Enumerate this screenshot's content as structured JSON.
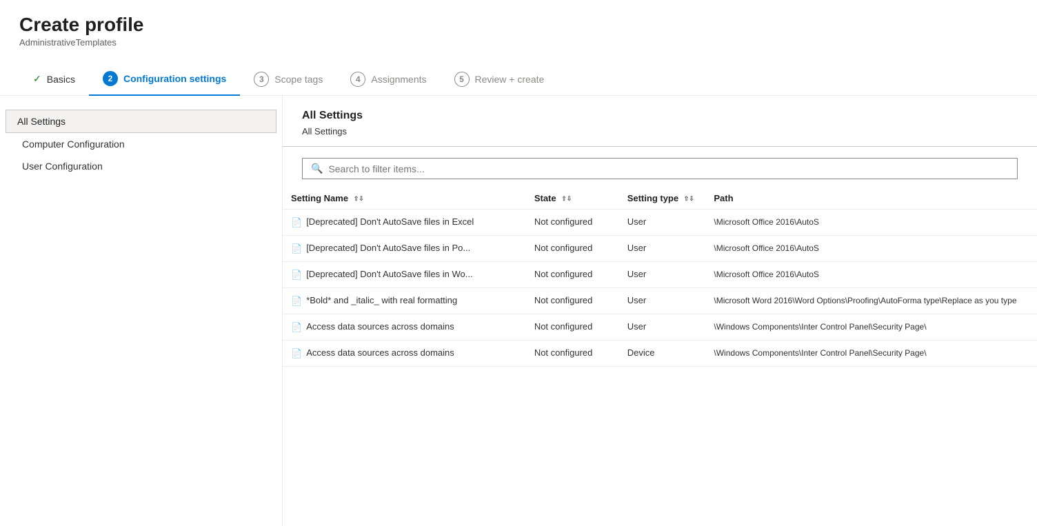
{
  "header": {
    "title": "Create profile",
    "subtitle": "AdministrativeTemplates"
  },
  "wizard": {
    "steps": [
      {
        "id": "basics",
        "number": "✓",
        "label": "Basics",
        "state": "completed"
      },
      {
        "id": "config",
        "number": "2",
        "label": "Configuration settings",
        "state": "active"
      },
      {
        "id": "scope",
        "number": "3",
        "label": "Scope tags",
        "state": "inactive"
      },
      {
        "id": "assignments",
        "number": "4",
        "label": "Assignments",
        "state": "inactive"
      },
      {
        "id": "review",
        "number": "5",
        "label": "Review + create",
        "state": "inactive"
      }
    ]
  },
  "sidebar": {
    "items": [
      {
        "id": "all-settings",
        "label": "All Settings",
        "selected": true,
        "level": 0
      },
      {
        "id": "computer-config",
        "label": "Computer Configuration",
        "selected": false,
        "level": 1
      },
      {
        "id": "user-config",
        "label": "User Configuration",
        "selected": false,
        "level": 1
      }
    ]
  },
  "content": {
    "heading": "All Settings",
    "breadcrumb": "All Settings",
    "search_placeholder": "Search to filter items...",
    "table": {
      "columns": [
        {
          "id": "setting-name",
          "label": "Setting Name"
        },
        {
          "id": "state",
          "label": "State"
        },
        {
          "id": "setting-type",
          "label": "Setting type"
        },
        {
          "id": "path",
          "label": "Path"
        }
      ],
      "rows": [
        {
          "name": "[Deprecated] Don't AutoSave files in Excel",
          "state": "Not configured",
          "type": "User",
          "path": "\\Microsoft Office 2016\\AutoS"
        },
        {
          "name": "[Deprecated] Don't AutoSave files in Po...",
          "state": "Not configured",
          "type": "User",
          "path": "\\Microsoft Office 2016\\AutoS"
        },
        {
          "name": "[Deprecated] Don't AutoSave files in Wo...",
          "state": "Not configured",
          "type": "User",
          "path": "\\Microsoft Office 2016\\AutoS"
        },
        {
          "name": "*Bold* and _italic_ with real formatting",
          "state": "Not configured",
          "type": "User",
          "path": "\\Microsoft Word 2016\\Word Options\\Proofing\\AutoForma type\\Replace as you type"
        },
        {
          "name": "Access data sources across domains",
          "state": "Not configured",
          "type": "User",
          "path": "\\Windows Components\\Inter Control Panel\\Security Page\\"
        },
        {
          "name": "Access data sources across domains",
          "state": "Not configured",
          "type": "Device",
          "path": "\\Windows Components\\Inter Control Panel\\Security Page\\"
        }
      ]
    }
  }
}
